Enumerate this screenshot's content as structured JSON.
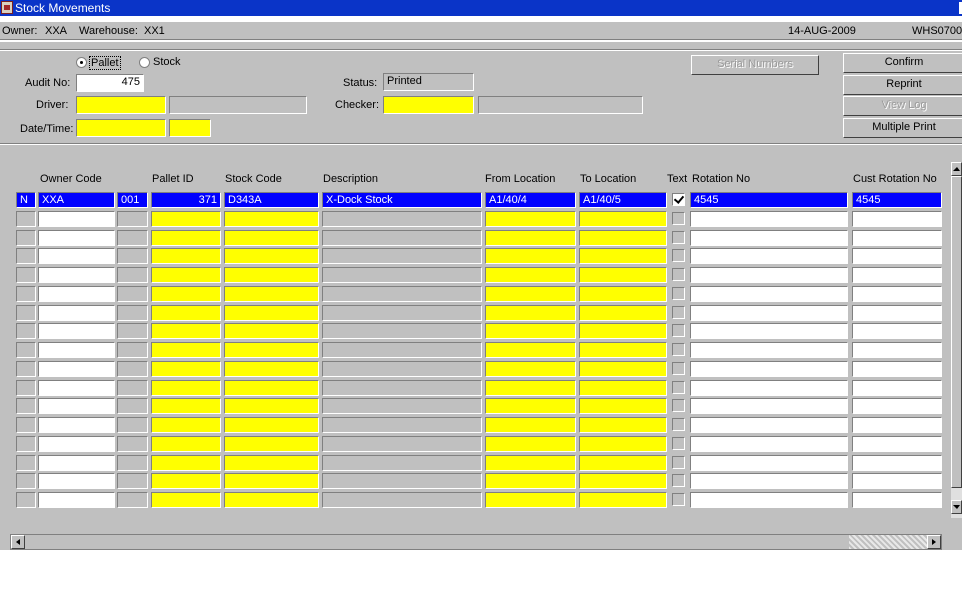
{
  "window": {
    "title": "Stock Movements"
  },
  "info": {
    "owner_label": "Owner:",
    "owner": "XXA",
    "warehouse_label": "Warehouse:",
    "warehouse": "XX1",
    "date": "14-AUG-2009",
    "screen_code": "WHS0700"
  },
  "form": {
    "mode_options": [
      "Pallet",
      "Stock"
    ],
    "mode_selected": "Pallet",
    "audit_label": "Audit No:",
    "audit_no": "475",
    "driver_label": "Driver:",
    "driver": "",
    "driver_name": "",
    "datetime_label": "Date/Time:",
    "date": "",
    "time": "",
    "status_label": "Status:",
    "status": "Printed",
    "checker_label": "Checker:",
    "checker": "",
    "checker_name": ""
  },
  "buttons": {
    "serial": "Serial Numbers",
    "confirm": "Confirm",
    "reprint": "Reprint",
    "viewlog": "View Log",
    "multiprint": "Multiple Print"
  },
  "grid": {
    "headers": {
      "owner_code": "Owner Code",
      "pallet_id": "Pallet ID",
      "stock_code": "Stock Code",
      "description": "Description",
      "from_location": "From Location",
      "to_location": "To Location",
      "text": "Text",
      "rotation_no": "Rotation No",
      "cust_rotation_no": "Cust Rotation No"
    },
    "rows": [
      {
        "flag": "N",
        "owner": "XXA",
        "sub": "001",
        "pallet": "371",
        "stock": "D343A",
        "desc": "X-Dock Stock",
        "from": "A1/40/4",
        "to": "A1/40/5",
        "text": true,
        "rotation": "4545",
        "cust_rotation": "4545",
        "selected": true
      },
      {
        "flag": "",
        "owner": "",
        "sub": "",
        "pallet": "",
        "stock": "",
        "desc": "",
        "from": "",
        "to": "",
        "text": false,
        "rotation": "",
        "cust_rotation": ""
      },
      {
        "flag": "",
        "owner": "",
        "sub": "",
        "pallet": "",
        "stock": "",
        "desc": "",
        "from": "",
        "to": "",
        "text": false,
        "rotation": "",
        "cust_rotation": ""
      },
      {
        "flag": "",
        "owner": "",
        "sub": "",
        "pallet": "",
        "stock": "",
        "desc": "",
        "from": "",
        "to": "",
        "text": false,
        "rotation": "",
        "cust_rotation": ""
      },
      {
        "flag": "",
        "owner": "",
        "sub": "",
        "pallet": "",
        "stock": "",
        "desc": "",
        "from": "",
        "to": "",
        "text": false,
        "rotation": "",
        "cust_rotation": ""
      },
      {
        "flag": "",
        "owner": "",
        "sub": "",
        "pallet": "",
        "stock": "",
        "desc": "",
        "from": "",
        "to": "",
        "text": false,
        "rotation": "",
        "cust_rotation": ""
      },
      {
        "flag": "",
        "owner": "",
        "sub": "",
        "pallet": "",
        "stock": "",
        "desc": "",
        "from": "",
        "to": "",
        "text": false,
        "rotation": "",
        "cust_rotation": ""
      },
      {
        "flag": "",
        "owner": "",
        "sub": "",
        "pallet": "",
        "stock": "",
        "desc": "",
        "from": "",
        "to": "",
        "text": false,
        "rotation": "",
        "cust_rotation": ""
      },
      {
        "flag": "",
        "owner": "",
        "sub": "",
        "pallet": "",
        "stock": "",
        "desc": "",
        "from": "",
        "to": "",
        "text": false,
        "rotation": "",
        "cust_rotation": ""
      },
      {
        "flag": "",
        "owner": "",
        "sub": "",
        "pallet": "",
        "stock": "",
        "desc": "",
        "from": "",
        "to": "",
        "text": false,
        "rotation": "",
        "cust_rotation": ""
      },
      {
        "flag": "",
        "owner": "",
        "sub": "",
        "pallet": "",
        "stock": "",
        "desc": "",
        "from": "",
        "to": "",
        "text": false,
        "rotation": "",
        "cust_rotation": ""
      },
      {
        "flag": "",
        "owner": "",
        "sub": "",
        "pallet": "",
        "stock": "",
        "desc": "",
        "from": "",
        "to": "",
        "text": false,
        "rotation": "",
        "cust_rotation": ""
      },
      {
        "flag": "",
        "owner": "",
        "sub": "",
        "pallet": "",
        "stock": "",
        "desc": "",
        "from": "",
        "to": "",
        "text": false,
        "rotation": "",
        "cust_rotation": ""
      },
      {
        "flag": "",
        "owner": "",
        "sub": "",
        "pallet": "",
        "stock": "",
        "desc": "",
        "from": "",
        "to": "",
        "text": false,
        "rotation": "",
        "cust_rotation": ""
      },
      {
        "flag": "",
        "owner": "",
        "sub": "",
        "pallet": "",
        "stock": "",
        "desc": "",
        "from": "",
        "to": "",
        "text": false,
        "rotation": "",
        "cust_rotation": ""
      },
      {
        "flag": "",
        "owner": "",
        "sub": "",
        "pallet": "",
        "stock": "",
        "desc": "",
        "from": "",
        "to": "",
        "text": false,
        "rotation": "",
        "cust_rotation": ""
      },
      {
        "flag": "",
        "owner": "",
        "sub": "",
        "pallet": "",
        "stock": "",
        "desc": "",
        "from": "",
        "to": "",
        "text": false,
        "rotation": "",
        "cust_rotation": ""
      }
    ]
  },
  "colors": {
    "titlebar": "#0a34c8",
    "required_field": "#ffff00",
    "selection": "#0000ff",
    "face": "#c0c0c0"
  }
}
